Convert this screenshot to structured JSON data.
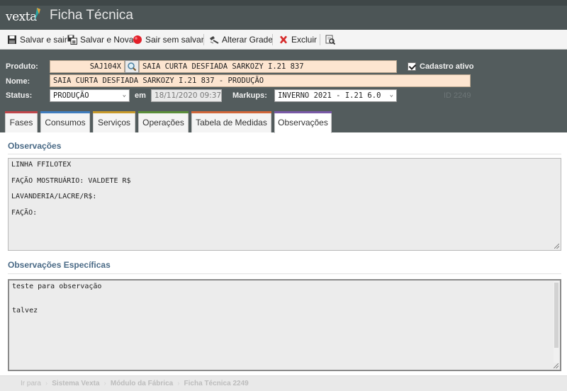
{
  "app": {
    "logo_text": "vexta",
    "title": "Ficha Técnica"
  },
  "toolbar": {
    "save_exit": "Salvar e sair",
    "save_new": "Salvar e Nova",
    "exit_no_save": "Sair sem salvar",
    "change_grid": "Alterar Grade",
    "delete": "Excluir"
  },
  "form": {
    "produto_label": "Produto:",
    "produto_code": "SAJ104X",
    "produto_desc": "SAIA CURTA DESFIADA SARKOZY I.21 837",
    "cadastro_ativo_label": "Cadastro ativo",
    "cadastro_ativo": true,
    "nome_label": "Nome:",
    "nome": "SAIA CURTA DESFIADA SARKOZY I.21 837 - PRODUÇÃO",
    "status_label": "Status:",
    "status": "PRODUÇÃO",
    "em_label": "em",
    "status_date": "18/11/2020 09:37",
    "markups_label": "Markups:",
    "markup": "INVERNO 2021 - I.21 6.0",
    "id_text": "ID 2249"
  },
  "tabs": [
    {
      "label": "Fases",
      "color": "#c0464b"
    },
    {
      "label": "Consumos",
      "color": "#3f7dbf"
    },
    {
      "label": "Serviços",
      "color": "#c89a2a"
    },
    {
      "label": "Operações",
      "color": "#5b8f3a"
    },
    {
      "label": "Tabela de Medidas",
      "color": "#d2673a"
    },
    {
      "label": "Observações",
      "color": "#7a5aa8",
      "active": true
    }
  ],
  "observacoes": {
    "title": "Observações",
    "lines": [
      "LINHA FFILOTEX",
      "FAÇÃO MOSTRUÁRIO: VALDETE R$",
      "LAVANDERIA/LACRE/R$:",
      "FAÇÃO:"
    ]
  },
  "observacoes_especificas": {
    "title": "Observações Específicas",
    "lines": [
      "teste para observação",
      "",
      "talvez"
    ]
  },
  "footer": {
    "go_to": "Ir para",
    "crumbs": [
      "Sistema Vexta",
      "Módulo da Fábrica",
      "Ficha Técnica 2249"
    ]
  },
  "colors": {
    "header_bg": "#4c5556",
    "form_bg": "#535c5d",
    "input_bg": "#fde5d0",
    "section_title": "#4a6a86"
  }
}
